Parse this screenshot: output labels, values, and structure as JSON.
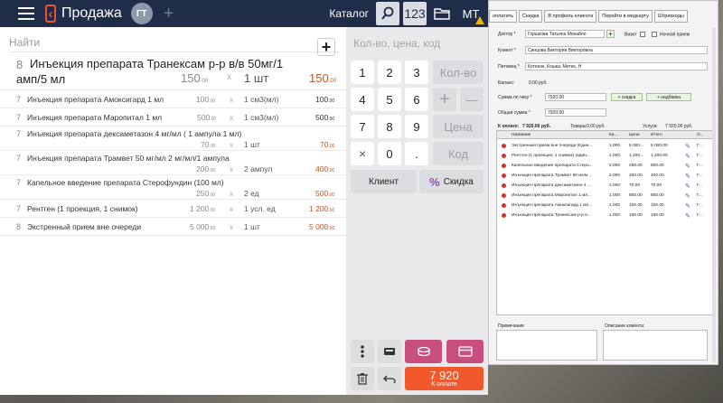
{
  "pos": {
    "header": {
      "title": "Продажа",
      "avatar": "ГТ",
      "catalog": "Каталог",
      "btn_123": "123",
      "user": "МТ"
    },
    "search_placeholder": "Найти",
    "items": [
      {
        "num": "8",
        "name": "Инъекция препарата Транексам р-р в/в 50мг/1",
        "name2": "амп/5 мл",
        "price": "150",
        "cents": ".00",
        "x": "x",
        "qty": "1 шт",
        "total": "150",
        "tcents": ".00"
      },
      {
        "num": "7",
        "name": "Инъекция препарата Амоксигард 1 мл",
        "price": "100",
        "cents": ".00",
        "x": "x",
        "qty": "1 см3(мл)",
        "total": "100",
        "tcents": ".00"
      },
      {
        "num": "7",
        "name": "Инъекция препарата Маропитал 1 мл",
        "price": "500",
        "cents": ".00",
        "x": "x",
        "qty": "1 см3(мл)",
        "total": "500",
        "tcents": ".00"
      },
      {
        "num": "7",
        "name": "Инъекция препарата дексаметазон 4 мг/мл ( 1 ампула 1 мл)",
        "price": "70",
        "cents": ".00",
        "x": "x",
        "qty": "1 шт",
        "total": "70",
        "tcents": ".00"
      },
      {
        "num": "7",
        "name": "Инъекция препарата Трамвет 50 мг/мл 2 мг/мл/1 ампула",
        "price": "200",
        "cents": ".00",
        "x": "x",
        "qty": "2 ампул",
        "total": "400",
        "tcents": ".00"
      },
      {
        "num": "7",
        "name": "Капельное введение препарата Стерофундин (100 мл)",
        "price": "250",
        "cents": ".00",
        "x": "x",
        "qty": "2 ед",
        "total": "500",
        "tcents": ".00"
      },
      {
        "num": "7",
        "name": "Рентген (1 проекция, 1 снимок)",
        "price": "1 200",
        "cents": ".00",
        "x": "x",
        "qty": "1 усл. ед",
        "total": "1 200",
        "tcents": ".00"
      },
      {
        "num": "8",
        "name": "Экстренный прием вне очереди",
        "price": "5 000",
        "cents": ".00",
        "x": "x",
        "qty": "1 шт",
        "total": "5 000",
        "tcents": ".00"
      }
    ],
    "pad": {
      "header": "Кол-во, цена, код",
      "k1": "1",
      "k2": "2",
      "k3": "3",
      "k4": "4",
      "k5": "5",
      "k6": "6",
      "k7": "7",
      "k8": "8",
      "k9": "9",
      "k0": "0",
      "dot": ".",
      "times": "×",
      "qty": "Кол-во",
      "plus": "+",
      "minus": "—",
      "price": "Цена",
      "code": "Код",
      "client": "Клиент",
      "discount": "Скидка",
      "pct": "%",
      "pay_sum": "7 920",
      "pay_label": "К оплате"
    }
  },
  "right": {
    "toolbar": [
      "оплатить",
      "Скидка",
      "В профиль клиента",
      "Перейти в медкарту",
      "Штрихкоды"
    ],
    "labels": {
      "doctor": "Доктор *",
      "client": "Клиент *",
      "pet": "Питомец *",
      "balance": "Баланс:",
      "sum_check": "Сумма по чеку *",
      "total": "Общая сумма *",
      "visit": "Визит",
      "night": "Ночной прием"
    },
    "values": {
      "doctor": "Горшкова Татьяна Михайло",
      "client": "Синцова Виктория Викторовна",
      "pet": "Котенок, Кошка, Метис, Н",
      "balance": "0.00 руб.",
      "sum_check": "7920.00",
      "total": "7920.00",
      "discount_btn": "+ скидка",
      "markup_btn": "+ надбавка"
    },
    "summary": {
      "pay": "К оплате:",
      "pay_val": "7 920.00 руб.",
      "goods": "Товары:",
      "goods_val": "0.00 руб.",
      "services": "Услуги:",
      "services_val": "7 920.00 руб."
    },
    "grid_headers": [
      "Название",
      "Ка...",
      "Цена",
      "Итого",
      "",
      "О..."
    ],
    "grid_rows": [
      [
        "Экстренный прием вне очереди (Един...",
        "1.000",
        "5 000...",
        "5 000.00",
        "Г..."
      ],
      [
        "Рентген (1 проекция, 1 снимок) (един...",
        "1.000",
        "1 200...",
        "1 200.00",
        "Г..."
      ],
      [
        "Капельное введение препарата Стеро...",
        "2.000",
        "250.00",
        "500.00",
        "Г..."
      ],
      [
        "Инъекция препарата Трамвет 50 мг/м...",
        "2.000",
        "200.00",
        "400.00",
        "Г..."
      ],
      [
        "Инъекция препарата дексаметазон 4 ...",
        "1.000",
        "70.00",
        "70.00",
        "Г..."
      ],
      [
        "Инъекция препарата Маропитал 1 мл...",
        "1.000",
        "500.00",
        "500.00",
        "Г..."
      ],
      [
        "Инъекция препарата Амоксигард 1 мл...",
        "1.000",
        "100.00",
        "100.00",
        "Г..."
      ],
      [
        "Инъекция препарата Транексам р-р в...",
        "1.000",
        "150.00",
        "150.00",
        "Г..."
      ]
    ],
    "notes_label": "Примечание",
    "client_desc_label": "Описание клиента:"
  }
}
